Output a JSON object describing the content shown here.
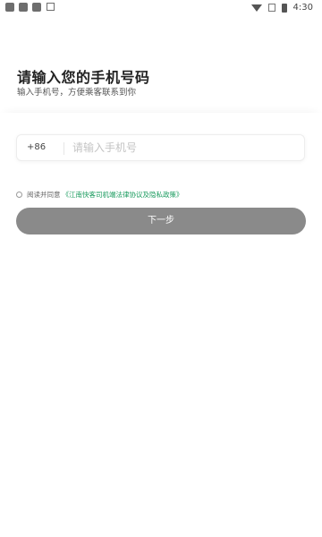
{
  "status_bar": {
    "time": "4:30",
    "left_icons": [
      "notification-icon",
      "notification-icon",
      "notification-icon",
      "storage-icon"
    ],
    "right_icons": [
      "wifi-icon",
      "signal-icon",
      "battery-icon"
    ]
  },
  "header": {
    "title": "请输入您的手机号码",
    "subtitle": "输入手机号，方便乘客联系到你"
  },
  "phone": {
    "country_code": "+86",
    "placeholder": "请输入手机号",
    "value": ""
  },
  "agreement": {
    "checked": false,
    "prefix": "阅读并同意",
    "link": "《江南快客司机端法律协议及隐私政策》"
  },
  "next_button": {
    "label": "下一步",
    "enabled": false
  },
  "colors": {
    "link": "#1a9b5e",
    "button_disabled": "#8a8a8a"
  }
}
